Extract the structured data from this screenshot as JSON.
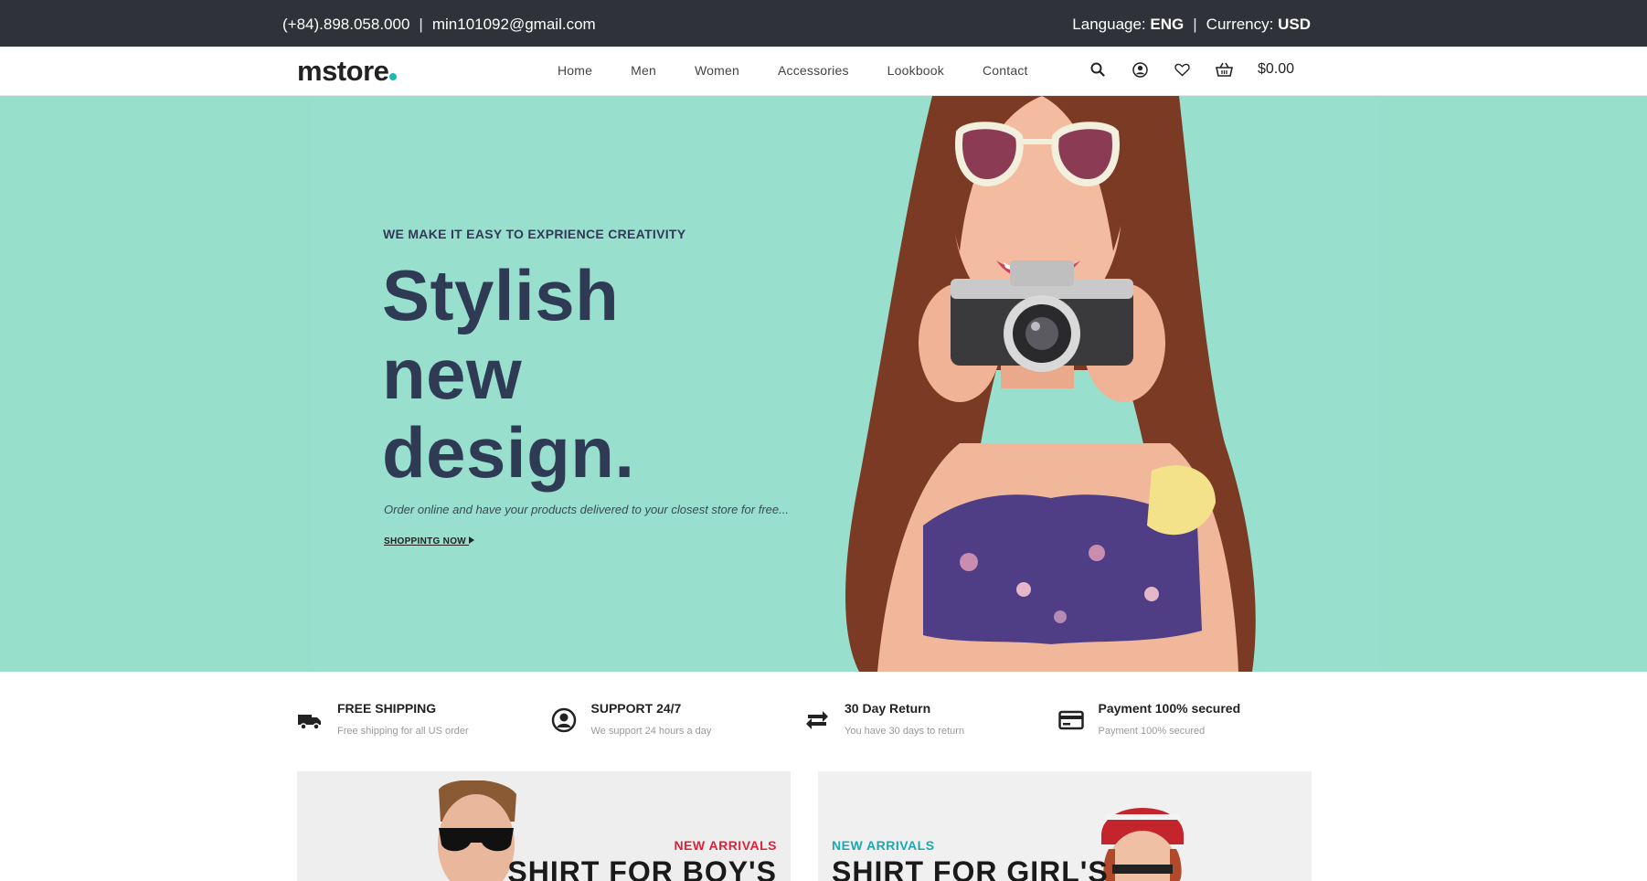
{
  "topbar": {
    "phone": "(+84).898.058.000",
    "separator": "|",
    "email": "min101092@gmail.com",
    "language_label": "Language:",
    "language_value": "ENG",
    "currency_label": "Currency:",
    "currency_value": "USD"
  },
  "nav": {
    "logo": "mstore",
    "menu": [
      "Home",
      "Men",
      "Women",
      "Accessories",
      "Lookbook",
      "Contact"
    ],
    "icons": [
      "search-icon",
      "user-icon",
      "heart-icon",
      "basket-icon"
    ],
    "cart_total": "$0.00"
  },
  "hero": {
    "eyebrow": "WE MAKE IT EASY TO EXPRIENCE CREATIVITY",
    "headline": [
      "Stylish",
      "new",
      "design."
    ],
    "subtext": "Order online and have your products delivered to your closest store for free...",
    "cta": "SHOPPINTG NOW",
    "bg_color": "#97dfcb"
  },
  "features": [
    {
      "title": "FREE SHIPPING",
      "subtitle": "Free shipping for all US order",
      "icon": "truck-icon"
    },
    {
      "title": "SUPPORT 24/7",
      "subtitle": "We support 24 hours a day",
      "icon": "user-circle-icon"
    },
    {
      "title": "30 Day Return",
      "subtitle": "You have 30 days to return",
      "icon": "return-icon"
    },
    {
      "title": "Payment 100% secured",
      "subtitle": "Payment 100% secured",
      "icon": "card-icon"
    }
  ],
  "banners": {
    "left": {
      "tag": "NEW ARRIVALS",
      "title": "SHIRT FOR BOY'S",
      "tag_color": "#e0203a"
    },
    "right": {
      "tag": "NEW ARRIVALS",
      "title": "SHIRT FOR GIRL'S",
      "tag_color": "#1aa9b3"
    }
  }
}
